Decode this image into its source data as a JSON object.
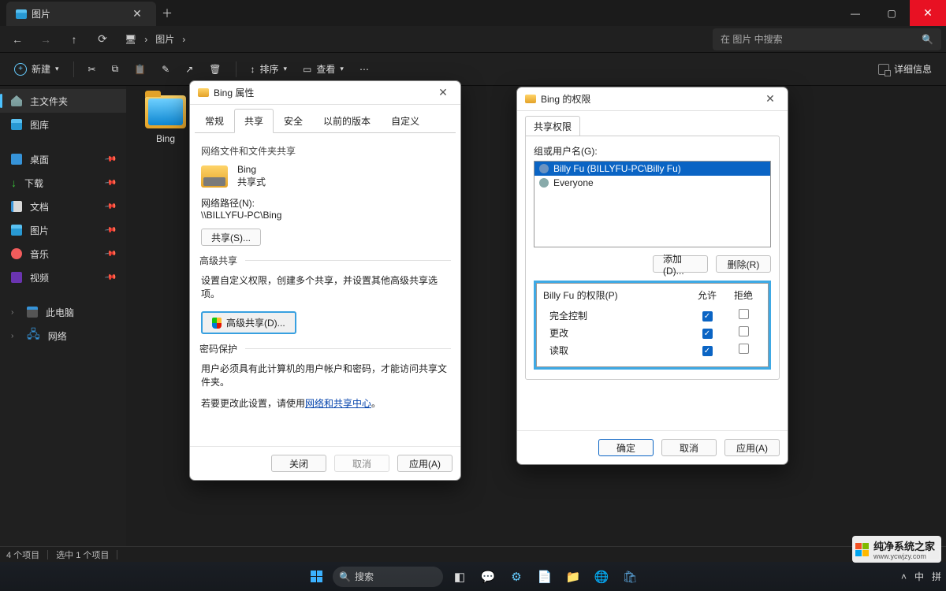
{
  "titlebar": {
    "tab_label": "图片"
  },
  "nav": {
    "monitor_tip": "此电脑",
    "breadcrumb": [
      "图片"
    ],
    "search_placeholder": "在 图片 中搜索"
  },
  "toolbar": {
    "new": "新建",
    "sort": "排序",
    "view": "查看",
    "details": "详细信息"
  },
  "sidebar": {
    "main": [
      {
        "label": "主文件夹",
        "icon": "home"
      },
      {
        "label": "图库",
        "icon": "lib"
      }
    ],
    "pinned": [
      {
        "label": "桌面",
        "icon": "desk"
      },
      {
        "label": "下载",
        "icon": "dl"
      },
      {
        "label": "文档",
        "icon": "doc"
      },
      {
        "label": "图片",
        "icon": "pic"
      },
      {
        "label": "音乐",
        "icon": "mus"
      },
      {
        "label": "视频",
        "icon": "vid"
      }
    ],
    "bottom": [
      {
        "label": "此电脑",
        "icon": "pc"
      },
      {
        "label": "网络",
        "icon": "net"
      }
    ]
  },
  "content": {
    "folder_name": "Bing"
  },
  "status": {
    "count": "4 个项目",
    "selected": "选中 1 个项目"
  },
  "props_dialog": {
    "title": "Bing 属性",
    "tabs": [
      "常规",
      "共享",
      "安全",
      "以前的版本",
      "自定义"
    ],
    "active_tab": 1,
    "section1": "网络文件和文件夹共享",
    "name_line1": "Bing",
    "name_line2": "共享式",
    "path_label": "网络路径(N):",
    "path_value": "\\\\BILLYFU-PC\\Bing",
    "share_btn": "共享(S)...",
    "section2": "高级共享",
    "adv_desc": "设置自定义权限，创建多个共享，并设置其他高级共享选项。",
    "adv_btn": "高级共享(D)...",
    "section3": "密码保护",
    "pwd_line1": "用户必须具有此计算机的用户帐户和密码，才能访问共享文件夹。",
    "pwd_line2a": "若要更改此设置，请使用",
    "pwd_link": "网络和共享中心",
    "buttons": {
      "close": "关闭",
      "cancel": "取消",
      "apply": "应用(A)"
    }
  },
  "perm_dialog": {
    "title": "Bing 的权限",
    "tab": "共享权限",
    "group_label": "组或用户名(G):",
    "users": [
      {
        "label": "Billy Fu (BILLYFU-PC\\Billy Fu)",
        "selected": true
      },
      {
        "label": "Everyone",
        "selected": false
      }
    ],
    "add": "添加(D)...",
    "remove": "删除(R)",
    "perm_for": "Billy Fu 的权限(P)",
    "col_allow": "允许",
    "col_deny": "拒绝",
    "rows": [
      {
        "label": "完全控制",
        "allow": true,
        "deny": false
      },
      {
        "label": "更改",
        "allow": true,
        "deny": false
      },
      {
        "label": "读取",
        "allow": true,
        "deny": false
      }
    ],
    "buttons": {
      "ok": "确定",
      "cancel": "取消",
      "apply": "应用(A)"
    }
  },
  "taskbar": {
    "search": "搜索",
    "ime": "中",
    "lang": "拼"
  },
  "watermark": {
    "brand": "纯净系统之家",
    "url": "www.ycwjzy.com"
  }
}
